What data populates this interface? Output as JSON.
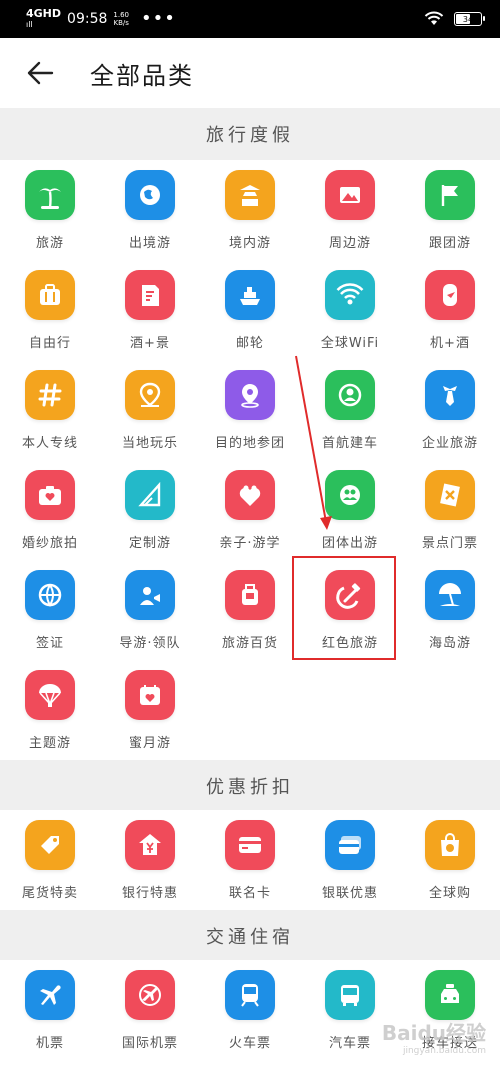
{
  "status": {
    "network": "4GHD",
    "network_sub": "ıll",
    "time": "09:58",
    "speed": "1.60",
    "speed_unit": "KB/s",
    "dots": "•••",
    "battery": "34"
  },
  "nav": {
    "title": "全部品类"
  },
  "sections": [
    {
      "title": "旅行度假"
    },
    {
      "title": "优惠折扣"
    },
    {
      "title": "交通住宿"
    }
  ],
  "travel_items": [
    {
      "label": "旅游",
      "icon": "palm-tree-icon",
      "color": "#2bbf5c"
    },
    {
      "label": "出境游",
      "icon": "globe-icon",
      "color": "#1e8fe6"
    },
    {
      "label": "境内游",
      "icon": "pagoda-icon",
      "color": "#f4a41e"
    },
    {
      "label": "周边游",
      "icon": "mountain-photo-icon",
      "color": "#f04b5a"
    },
    {
      "label": "跟团游",
      "icon": "flag-icon",
      "color": "#2bbf5c"
    },
    {
      "label": "自由行",
      "icon": "suitcase-icon",
      "color": "#f4a41e"
    },
    {
      "label": "酒+景",
      "icon": "ticket-icon",
      "color": "#f04b5a"
    },
    {
      "label": "邮轮",
      "icon": "cruise-ship-icon",
      "color": "#1e8fe6"
    },
    {
      "label": "全球WiFi",
      "icon": "wifi-icon",
      "color": "#23b9c9"
    },
    {
      "label": "机+酒",
      "icon": "plane-door-icon",
      "color": "#f04b5a"
    },
    {
      "label": "本人专线",
      "icon": "hashtag-icon",
      "color": "#f4a41e"
    },
    {
      "label": "当地玩乐",
      "icon": "location-pin-icon",
      "color": "#f4a41e"
    },
    {
      "label": "目的地参团",
      "icon": "map-pin-icon",
      "color": "#8e5be8"
    },
    {
      "label": "首航建车",
      "icon": "user-circle-icon",
      "color": "#2bbf5c"
    },
    {
      "label": "企业旅游",
      "icon": "necktie-icon",
      "color": "#1e8fe6"
    },
    {
      "label": "婚纱旅拍",
      "icon": "camera-heart-icon",
      "color": "#f04b5a"
    },
    {
      "label": "定制游",
      "icon": "ruler-triangle-icon",
      "color": "#23b9c9"
    },
    {
      "label": "亲子·游学",
      "icon": "family-heart-icon",
      "color": "#f04b5a"
    },
    {
      "label": "团体出游",
      "icon": "group-icon",
      "color": "#2bbf5c"
    },
    {
      "label": "景点门票",
      "icon": "ticket-stub-icon",
      "color": "#f4a41e"
    },
    {
      "label": "签证",
      "icon": "passport-globe-icon",
      "color": "#1e8fe6"
    },
    {
      "label": "导游·领队",
      "icon": "guide-flag-icon",
      "color": "#1e8fe6"
    },
    {
      "label": "旅游百货",
      "icon": "luggage-icon",
      "color": "#f04b5a"
    },
    {
      "label": "红色旅游",
      "icon": "hammer-sickle-icon",
      "color": "#f04b5a"
    },
    {
      "label": "海岛游",
      "icon": "beach-umbrella-icon",
      "color": "#1e8fe6"
    },
    {
      "label": "主题游",
      "icon": "parachute-icon",
      "color": "#f04b5a"
    },
    {
      "label": "蜜月游",
      "icon": "calendar-heart-icon",
      "color": "#f04b5a"
    }
  ],
  "discount_items": [
    {
      "label": "尾货特卖",
      "icon": "price-tag-icon",
      "color": "#f4a41e"
    },
    {
      "label": "银行特惠",
      "icon": "bank-yen-icon",
      "color": "#f04b5a"
    },
    {
      "label": "联名卡",
      "icon": "credit-card-icon",
      "color": "#f04b5a"
    },
    {
      "label": "银联优惠",
      "icon": "card-stack-icon",
      "color": "#1e8fe6"
    },
    {
      "label": "全球购",
      "icon": "shopping-bag-globe-icon",
      "color": "#f4a41e"
    }
  ],
  "transport_items": [
    {
      "label": "机票",
      "icon": "airplane-icon",
      "color": "#1e8fe6"
    },
    {
      "label": "国际机票",
      "icon": "intl-plane-icon",
      "color": "#f04b5a"
    },
    {
      "label": "火车票",
      "icon": "train-icon",
      "color": "#1e8fe6"
    },
    {
      "label": "汽车票",
      "icon": "bus-icon",
      "color": "#23b9c9"
    },
    {
      "label": "接车接送",
      "icon": "taxi-icon",
      "color": "#2bbf5c"
    }
  ],
  "watermark": {
    "text": "Baidu经验",
    "sub": "jingyan.baidu.com"
  }
}
